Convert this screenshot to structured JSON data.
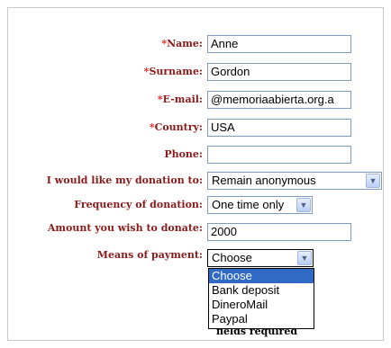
{
  "form": {
    "name": {
      "asterisk": "*",
      "label": "Name:",
      "value": "Anne"
    },
    "surname": {
      "asterisk": "*",
      "label": "Surname:",
      "value": "Gordon"
    },
    "email": {
      "asterisk": "*",
      "label": "E-mail:",
      "value": "@memoriaabierta.org.a"
    },
    "country": {
      "asterisk": "*",
      "label": "Country:",
      "value": "USA"
    },
    "phone": {
      "label": "Phone:",
      "value": ""
    },
    "donation_to": {
      "label": "I would like my donation to:",
      "selected": "Remain anonymous"
    },
    "frequency": {
      "label": "Frequency of donation:",
      "selected": "One time only"
    },
    "amount": {
      "label": "Amount you wish to donate:",
      "value": "2000"
    },
    "payment": {
      "label": "Means of payment:",
      "selected": "Choose",
      "options": [
        "Choose",
        "Bank deposit",
        "DineroMail",
        "Paypal"
      ]
    },
    "fields_required": "fields required"
  }
}
